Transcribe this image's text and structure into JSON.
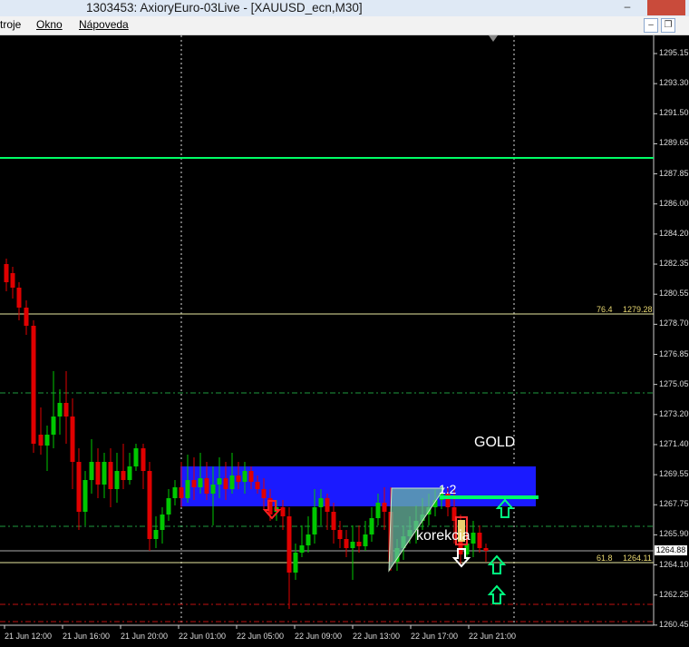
{
  "window": {
    "title": "1303453: AxioryEuro-03Live - [XAUUSD_ecn,M30]",
    "minimize_glyph": "–",
    "restore_glyph": "❐"
  },
  "menu": {
    "items": [
      "troje",
      "Okno",
      "Nápoveda"
    ]
  },
  "chart": {
    "symbol_label": "GOLD",
    "correction_label": "korekcia",
    "ratio_label": "1:2",
    "price_axis": [
      "1295.15",
      "1293.30",
      "1291.50",
      "1289.65",
      "1287.85",
      "1286.00",
      "1284.20",
      "1282.35",
      "1280.55",
      "1278.70",
      "1276.85",
      "1275.05",
      "1273.20",
      "1271.40",
      "1269.55",
      "1267.75",
      "1265.90",
      "1264.10",
      "1262.25",
      "1260.45"
    ],
    "time_axis": [
      "21 Jun 12:00",
      "21 Jun 16:00",
      "21 Jun 20:00",
      "22 Jun 01:00",
      "22 Jun 05:00",
      "22 Jun 09:00",
      "22 Jun 13:00",
      "22 Jun 17:00",
      "22 Jun 21:00"
    ],
    "current_price": "1264.88",
    "fib_levels": [
      {
        "ratio": "76.4",
        "price": "1279.28"
      },
      {
        "ratio": "61.8",
        "price": "1264.11"
      }
    ],
    "colors": {
      "bull": "#00c800",
      "bear": "#e00000",
      "zone": "#1a1aff",
      "level_line": "#00ff66",
      "fib_line": "#e8e8a0",
      "arrow_up": "#00ff80",
      "arrow_down": "#ff2020"
    }
  }
}
